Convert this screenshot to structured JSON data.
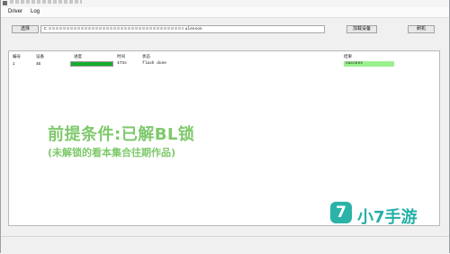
{
  "menu": {
    "items": [
      "Driver",
      "Log"
    ]
  },
  "toolbar": {
    "select_label": "选择",
    "path_prefix": "C",
    "path_suffix": "ulesson",
    "load_device_label": "加载设备",
    "flash_label": "刷机"
  },
  "table": {
    "headers": [
      "编号",
      "设备",
      "进度",
      "时间",
      "状态",
      "结果"
    ],
    "rows": [
      {
        "index": "1",
        "device": "4E",
        "progress_percent": 100,
        "time": "473s",
        "status": "flash done",
        "result": "success"
      }
    ]
  },
  "watermark": {
    "line1": "前提条件:已解BL锁",
    "line2": "(未解锁的看本集合往期作品)"
  },
  "brand": {
    "logo_char": "7",
    "name": "小7手游"
  },
  "colors": {
    "progress_fill": "#14ad2b",
    "result_bg": "#9bf08f",
    "watermark": "#7ec96b",
    "brand": "#24b0a8"
  }
}
